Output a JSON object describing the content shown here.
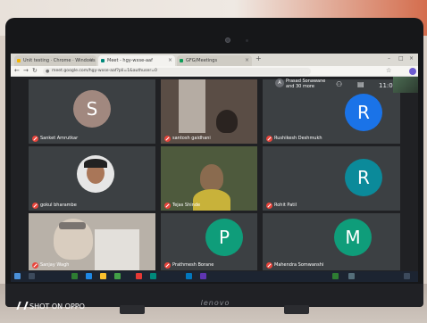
{
  "browser": {
    "tabs": [
      {
        "label": "Unit testing · Chrome · Windows",
        "active": false
      },
      {
        "label": "Meet - hgy-wxse-aaf",
        "active": true
      },
      {
        "label": "GFG/Meetings",
        "active": false
      }
    ],
    "new_tab": "+",
    "url": "meet.google.com/hgy-wxse-aaf?pli=1&authuser=0"
  },
  "meeting": {
    "top_bar": {
      "presenter_initial": "A",
      "presenter_line1": "Prasad Sonawane",
      "presenter_line2": "and 30 more",
      "time": "11:01"
    },
    "participants": [
      {
        "name": "Sanket Amrutkar",
        "initial": "S",
        "avatar_color": "#a1887f",
        "kind": "avatar"
      },
      {
        "name": "santosh gaidhani",
        "initial": "",
        "avatar_color": "",
        "kind": "video"
      },
      {
        "name": "Rushikesh Deshmukh",
        "initial": "R",
        "avatar_color": "#1a73e8",
        "kind": "avatar"
      },
      {
        "name": "gokul bharambe",
        "initial": "",
        "avatar_color": "",
        "kind": "photo"
      },
      {
        "name": "Tejas Shinde",
        "initial": "",
        "avatar_color": "",
        "kind": "video"
      },
      {
        "name": "Rohit Patil",
        "initial": "R",
        "avatar_color": "#0b8a9a",
        "kind": "avatar"
      },
      {
        "name": "Sanjay Wagh",
        "initial": "",
        "avatar_color": "",
        "kind": "video"
      },
      {
        "name": "Prathmesh Borane",
        "initial": "P",
        "avatar_color": "#0f9d7a",
        "kind": "avatar"
      },
      {
        "name": "Mahendra Somwanshi",
        "initial": "M",
        "avatar_color": "#0f9d7a",
        "kind": "avatar"
      }
    ]
  },
  "device": {
    "brand": "lenovo",
    "watermark": "SHOT ON OPPO"
  },
  "colors": {
    "meet_bg": "#202124",
    "tile_bg": "#3c4043",
    "mic_muted": "#e8453c"
  }
}
